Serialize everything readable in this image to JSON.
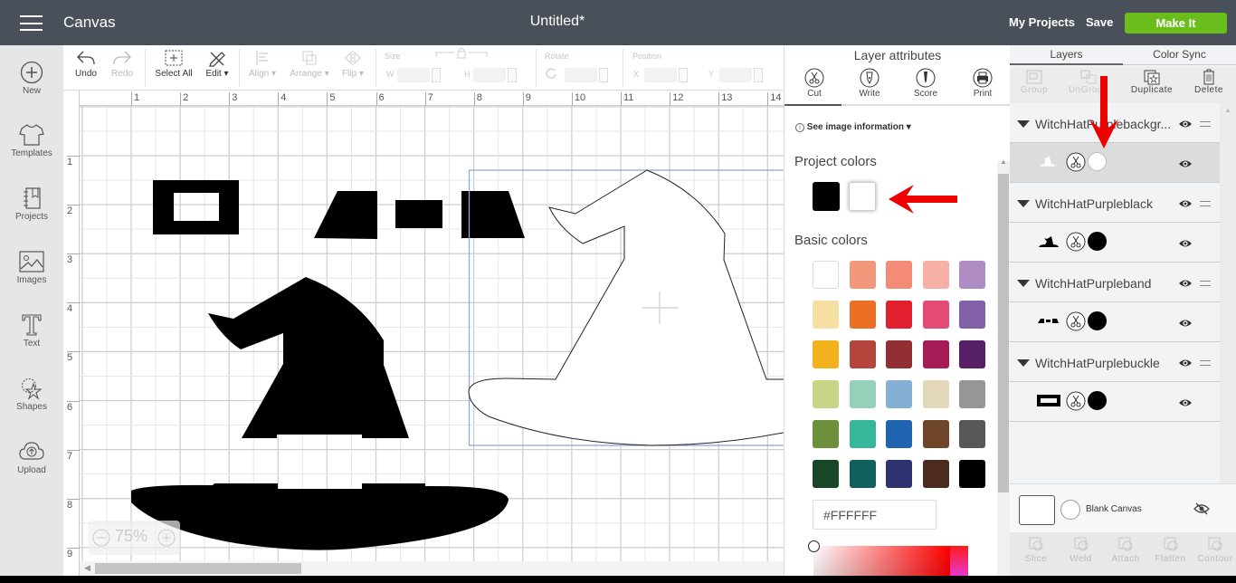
{
  "topbar": {
    "app_title": "Canvas",
    "doc_title": "Untitled*",
    "my_projects": "My Projects",
    "save": "Save",
    "make_it": "Make It",
    "make_it_color": "#6bbd1b"
  },
  "leftnav": [
    {
      "label": "New",
      "icon": "plus-circle-icon"
    },
    {
      "label": "Templates",
      "icon": "tshirt-icon"
    },
    {
      "label": "Projects",
      "icon": "notebook-icon"
    },
    {
      "label": "Images",
      "icon": "image-icon"
    },
    {
      "label": "Text",
      "icon": "text-icon"
    },
    {
      "label": "Shapes",
      "icon": "shapes-icon"
    },
    {
      "label": "Upload",
      "icon": "cloud-upload-icon"
    }
  ],
  "toolbar": {
    "undo": "Undo",
    "redo": "Redo",
    "select_all": "Select All",
    "edit": "Edit",
    "align": "Align",
    "arrange": "Arrange",
    "flip": "Flip",
    "size_label": "Size",
    "w_label": "W",
    "h_label": "H",
    "rotate_label": "Rotate",
    "position_label": "Position",
    "x_label": "X",
    "y_label": "Y"
  },
  "ruler": {
    "top": [
      "1",
      "2",
      "3",
      "4",
      "5",
      "6",
      "7",
      "8",
      "9",
      "10",
      "11",
      "12",
      "13",
      "14"
    ],
    "left": [
      "1",
      "2",
      "3",
      "4",
      "5",
      "6",
      "7",
      "8",
      "9"
    ]
  },
  "zoom": {
    "level": "75%"
  },
  "attributes": {
    "title": "Layer attributes",
    "tabs": [
      {
        "label": "Cut",
        "icon": "scissors-icon"
      },
      {
        "label": "Write",
        "icon": "pen-icon"
      },
      {
        "label": "Score",
        "icon": "score-icon"
      },
      {
        "label": "Print",
        "icon": "printer-icon"
      }
    ],
    "active_tab": "Cut",
    "see_info": "See image information",
    "project_colors_title": "Project colors",
    "project_colors": [
      "#000000",
      "#FFFFFF"
    ],
    "basic_colors_title": "Basic colors",
    "basic_colors": [
      [
        "#FFFFFF",
        "#F1997A",
        "#F38B77",
        "#F6B0A6",
        "#B08CC4"
      ],
      [
        "#F5DFA2",
        "#EB7023",
        "#E21F2E",
        "#E34B76",
        "#8260A8"
      ],
      [
        "#F3B21B",
        "#B5463D",
        "#922F33",
        "#A61C57",
        "#572066"
      ],
      [
        "#C9D584",
        "#94D1B9",
        "#86AFD5",
        "#E2D8B9",
        "#969696"
      ],
      [
        "#6D903C",
        "#36B79C",
        "#1E64B0",
        "#6E4529",
        "#585858"
      ],
      [
        "#174726",
        "#0E615C",
        "#2C3370",
        "#4C2A1E",
        "#000000"
      ]
    ],
    "hex_value": "#FFFFFF"
  },
  "layers_panel": {
    "tabs": [
      "Layers",
      "Color Sync"
    ],
    "actions": [
      "Group",
      "UnGroup",
      "Duplicate",
      "Delete"
    ],
    "groups": [
      {
        "name": "WitchHatPurplebackgr...",
        "color": "#FFFFFF",
        "selected": true
      },
      {
        "name": "WitchHatPurpleblack",
        "color": "#000000",
        "selected": false
      },
      {
        "name": "WitchHatPurpleband",
        "color": "#000000",
        "selected": false
      },
      {
        "name": "WitchHatPurplebuckle",
        "color": "#000000",
        "selected": false
      }
    ],
    "blank_canvas": "Blank Canvas",
    "bottom_actions": [
      "Slice",
      "Weld",
      "Attach",
      "Flatten",
      "Contour"
    ]
  }
}
